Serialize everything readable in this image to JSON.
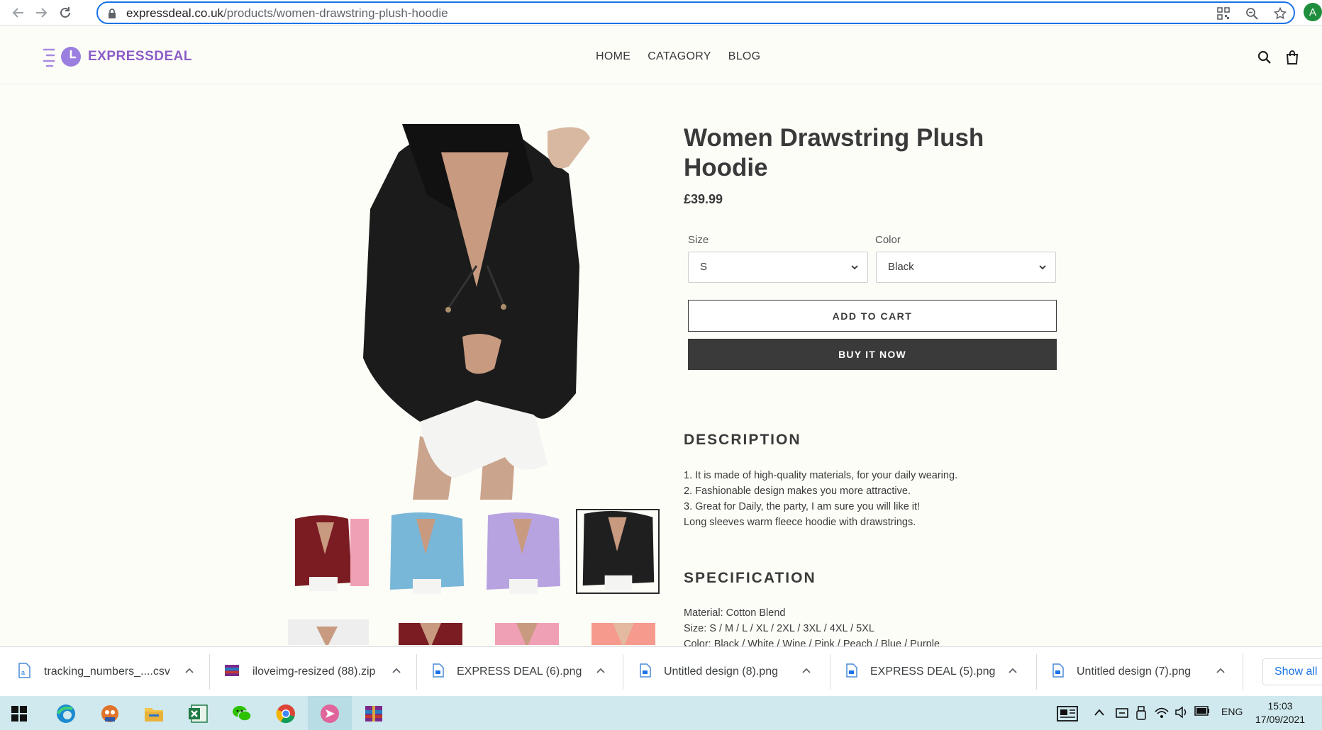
{
  "browser": {
    "url_host": "expressdeal.co.uk",
    "url_path": "/products/women-drawstring-plush-hoodie",
    "profile_initial": "A"
  },
  "site": {
    "logo_text": "EXPRESSDEAL",
    "nav": [
      "HOME",
      "CATAGORY",
      "BLOG"
    ]
  },
  "product": {
    "title": "Women Drawstring Plush Hoodie",
    "price": "£39.99",
    "size_label": "Size",
    "size_value": "S",
    "color_label": "Color",
    "color_value": "Black",
    "add_to_cart": "ADD TO CART",
    "buy_now": "BUY IT NOW",
    "thumb_colors": [
      "#7a1c22",
      "#79b7d9",
      "#b7a3e0",
      "#1f1f1f"
    ],
    "thumb_colors_row2": [
      "#eeeeee",
      "#7a1c22",
      "#f0a0b4",
      "#f59a8c"
    ],
    "description_heading": "DESCRIPTION",
    "description_lines": [
      "1. It is made of high-quality materials, for your daily wearing.",
      "2. Fashionable design makes you more attractive.",
      "3. Great for Daily, the party, I am sure you will like it!",
      "Long sleeves warm fleece hoodie with drawstrings."
    ],
    "specification_heading": "SPECIFICATION",
    "specification_lines": [
      "Material: Cotton Blend",
      "Size: S / M / L / XL / 2XL / 3XL / 4XL / 5XL",
      "Color: Black / White / Wine / Pink / Peach / Blue / Purple"
    ]
  },
  "downloads": {
    "items": [
      "tracking_numbers_....csv",
      "iloveimg-resized (88).zip",
      "EXPRESS DEAL (6).png",
      "Untitled design (8).png",
      "EXPRESS DEAL (5).png",
      "Untitled design (7).png"
    ],
    "show_all": "Show all"
  },
  "taskbar": {
    "language": "ENG",
    "time": "15:03",
    "date": "17/09/2021"
  }
}
